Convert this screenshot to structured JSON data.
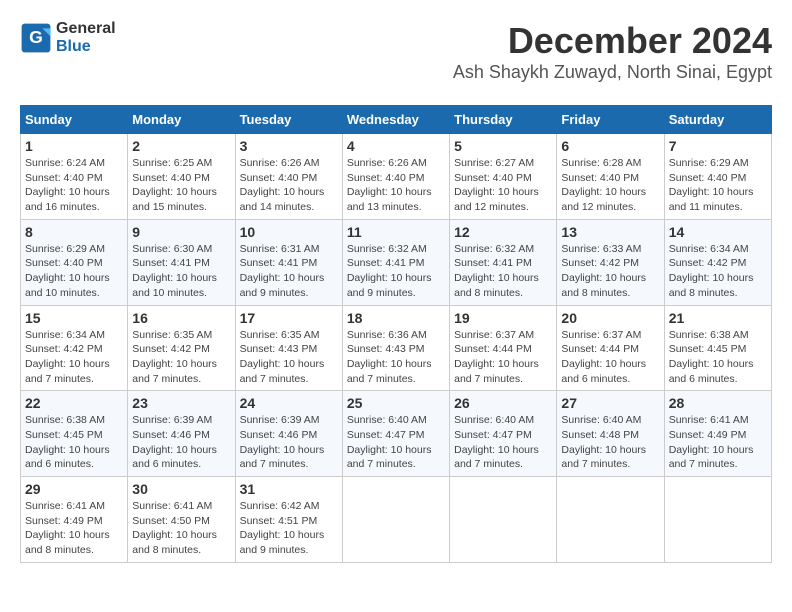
{
  "header": {
    "logo_line1": "General",
    "logo_line2": "Blue",
    "month_title": "December 2024",
    "location": "Ash Shaykh Zuwayd, North Sinai, Egypt"
  },
  "weekdays": [
    "Sunday",
    "Monday",
    "Tuesday",
    "Wednesday",
    "Thursday",
    "Friday",
    "Saturday"
  ],
  "weeks": [
    [
      {
        "day": "1",
        "sunrise": "6:24 AM",
        "sunset": "4:40 PM",
        "daylight": "10 hours and 16 minutes."
      },
      {
        "day": "2",
        "sunrise": "6:25 AM",
        "sunset": "4:40 PM",
        "daylight": "10 hours and 15 minutes."
      },
      {
        "day": "3",
        "sunrise": "6:26 AM",
        "sunset": "4:40 PM",
        "daylight": "10 hours and 14 minutes."
      },
      {
        "day": "4",
        "sunrise": "6:26 AM",
        "sunset": "4:40 PM",
        "daylight": "10 hours and 13 minutes."
      },
      {
        "day": "5",
        "sunrise": "6:27 AM",
        "sunset": "4:40 PM",
        "daylight": "10 hours and 12 minutes."
      },
      {
        "day": "6",
        "sunrise": "6:28 AM",
        "sunset": "4:40 PM",
        "daylight": "10 hours and 12 minutes."
      },
      {
        "day": "7",
        "sunrise": "6:29 AM",
        "sunset": "4:40 PM",
        "daylight": "10 hours and 11 minutes."
      }
    ],
    [
      {
        "day": "8",
        "sunrise": "6:29 AM",
        "sunset": "4:40 PM",
        "daylight": "10 hours and 10 minutes."
      },
      {
        "day": "9",
        "sunrise": "6:30 AM",
        "sunset": "4:41 PM",
        "daylight": "10 hours and 10 minutes."
      },
      {
        "day": "10",
        "sunrise": "6:31 AM",
        "sunset": "4:41 PM",
        "daylight": "10 hours and 9 minutes."
      },
      {
        "day": "11",
        "sunrise": "6:32 AM",
        "sunset": "4:41 PM",
        "daylight": "10 hours and 9 minutes."
      },
      {
        "day": "12",
        "sunrise": "6:32 AM",
        "sunset": "4:41 PM",
        "daylight": "10 hours and 8 minutes."
      },
      {
        "day": "13",
        "sunrise": "6:33 AM",
        "sunset": "4:42 PM",
        "daylight": "10 hours and 8 minutes."
      },
      {
        "day": "14",
        "sunrise": "6:34 AM",
        "sunset": "4:42 PM",
        "daylight": "10 hours and 8 minutes."
      }
    ],
    [
      {
        "day": "15",
        "sunrise": "6:34 AM",
        "sunset": "4:42 PM",
        "daylight": "10 hours and 7 minutes."
      },
      {
        "day": "16",
        "sunrise": "6:35 AM",
        "sunset": "4:42 PM",
        "daylight": "10 hours and 7 minutes."
      },
      {
        "day": "17",
        "sunrise": "6:35 AM",
        "sunset": "4:43 PM",
        "daylight": "10 hours and 7 minutes."
      },
      {
        "day": "18",
        "sunrise": "6:36 AM",
        "sunset": "4:43 PM",
        "daylight": "10 hours and 7 minutes."
      },
      {
        "day": "19",
        "sunrise": "6:37 AM",
        "sunset": "4:44 PM",
        "daylight": "10 hours and 7 minutes."
      },
      {
        "day": "20",
        "sunrise": "6:37 AM",
        "sunset": "4:44 PM",
        "daylight": "10 hours and 6 minutes."
      },
      {
        "day": "21",
        "sunrise": "6:38 AM",
        "sunset": "4:45 PM",
        "daylight": "10 hours and 6 minutes."
      }
    ],
    [
      {
        "day": "22",
        "sunrise": "6:38 AM",
        "sunset": "4:45 PM",
        "daylight": "10 hours and 6 minutes."
      },
      {
        "day": "23",
        "sunrise": "6:39 AM",
        "sunset": "4:46 PM",
        "daylight": "10 hours and 6 minutes."
      },
      {
        "day": "24",
        "sunrise": "6:39 AM",
        "sunset": "4:46 PM",
        "daylight": "10 hours and 7 minutes."
      },
      {
        "day": "25",
        "sunrise": "6:40 AM",
        "sunset": "4:47 PM",
        "daylight": "10 hours and 7 minutes."
      },
      {
        "day": "26",
        "sunrise": "6:40 AM",
        "sunset": "4:47 PM",
        "daylight": "10 hours and 7 minutes."
      },
      {
        "day": "27",
        "sunrise": "6:40 AM",
        "sunset": "4:48 PM",
        "daylight": "10 hours and 7 minutes."
      },
      {
        "day": "28",
        "sunrise": "6:41 AM",
        "sunset": "4:49 PM",
        "daylight": "10 hours and 7 minutes."
      }
    ],
    [
      {
        "day": "29",
        "sunrise": "6:41 AM",
        "sunset": "4:49 PM",
        "daylight": "10 hours and 8 minutes."
      },
      {
        "day": "30",
        "sunrise": "6:41 AM",
        "sunset": "4:50 PM",
        "daylight": "10 hours and 8 minutes."
      },
      {
        "day": "31",
        "sunrise": "6:42 AM",
        "sunset": "4:51 PM",
        "daylight": "10 hours and 9 minutes."
      },
      null,
      null,
      null,
      null
    ]
  ]
}
